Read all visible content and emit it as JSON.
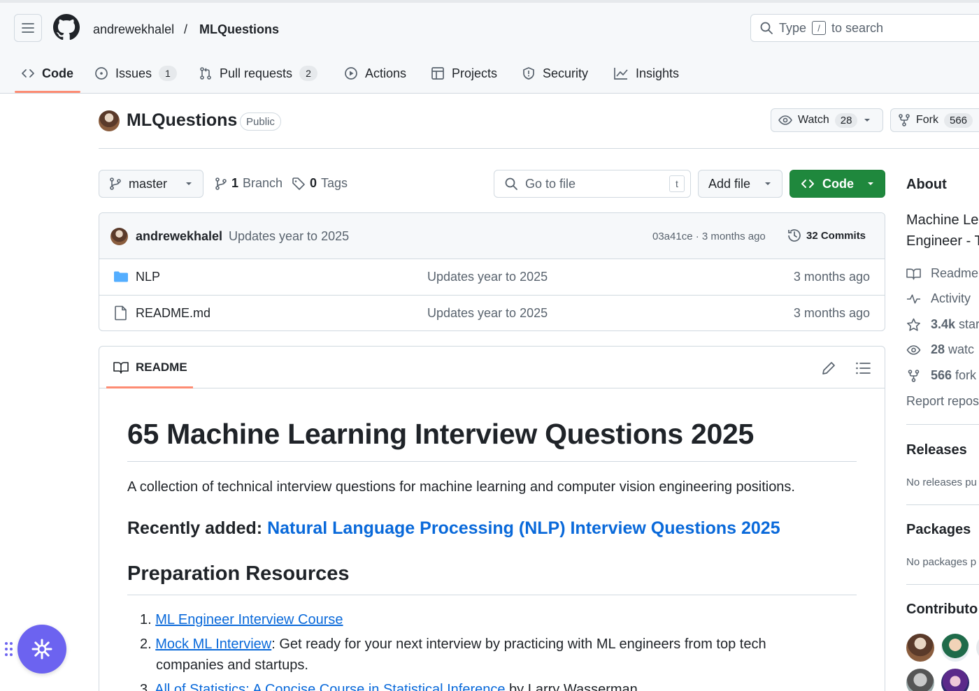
{
  "header": {
    "owner": "andrewekhalel",
    "separator": "/",
    "repo": "MLQuestions",
    "search_prefix": "Type",
    "search_key": "/",
    "search_suffix": "to search"
  },
  "tabs": [
    {
      "label": "Code",
      "icon": "code-icon",
      "active": true
    },
    {
      "label": "Issues",
      "icon": "issue-icon",
      "count": "1"
    },
    {
      "label": "Pull requests",
      "icon": "pull-request-icon",
      "count": "2"
    },
    {
      "label": "Actions",
      "icon": "play-icon"
    },
    {
      "label": "Projects",
      "icon": "table-icon"
    },
    {
      "label": "Security",
      "icon": "shield-icon"
    },
    {
      "label": "Insights",
      "icon": "graph-icon"
    }
  ],
  "repo": {
    "name": "MLQuestions",
    "visibility": "Public",
    "watch_label": "Watch",
    "watch_count": "28",
    "fork_label": "Fork",
    "fork_count": "566"
  },
  "branchbar": {
    "branch": "master",
    "branches_count": "1",
    "branches_label": "Branch",
    "tags_count": "0",
    "tags_label": "Tags",
    "goto_placeholder": "Go to file",
    "goto_key": "t",
    "add_file": "Add file",
    "code": "Code"
  },
  "commit": {
    "author": "andrewekhalel",
    "message": "Updates year to 2025",
    "sha_time": "03a41ce · 3 months ago",
    "commits": "32 Commits"
  },
  "files": [
    {
      "name": "NLP",
      "type": "folder",
      "message": "Updates year to 2025",
      "time": "3 months ago"
    },
    {
      "name": "README.md",
      "type": "file",
      "message": "Updates year to 2025",
      "time": "3 months ago"
    }
  ],
  "readme": {
    "tab": "README",
    "title": "65 Machine Learning Interview Questions 2025",
    "intro": "A collection of technical interview questions for machine learning and computer vision engineering positions.",
    "recent_label": "Recently added:",
    "recent_link": "Natural Language Processing (NLP) Interview Questions 2025",
    "resources_heading": "Preparation Resources",
    "resources": [
      {
        "num": "1.",
        "link": "ML Engineer Interview Course",
        "rest": ""
      },
      {
        "num": "2.",
        "link": "Mock ML Interview",
        "rest": ": Get ready for your next interview by practicing with ML engineers from top tech",
        "rest2": "companies and startups."
      },
      {
        "num": "3.",
        "link": "All of Statistics: A Concise Course in Statistical Inference",
        "rest": " by Larry Wasserman"
      }
    ]
  },
  "about": {
    "heading": "About",
    "desc_line1": "Machine Le",
    "desc_line2": "Engineer - T",
    "readme": "Readme",
    "activity": "Activity",
    "stars": "3.4k",
    "stars_suffix": " star",
    "watching": "28",
    "watching_suffix": " watc",
    "forks": "566",
    "forks_suffix": " fork",
    "report": "Report repos"
  },
  "releases": {
    "heading": "Releases",
    "text": "No releases pu"
  },
  "packages": {
    "heading": "Packages",
    "text": "No packages p"
  },
  "contributors": {
    "heading": "Contributo"
  },
  "colors": {
    "accent_underline": "#fd8c73",
    "link": "#0969da",
    "code_button": "#1f883d",
    "widget": "#6c63f0"
  }
}
